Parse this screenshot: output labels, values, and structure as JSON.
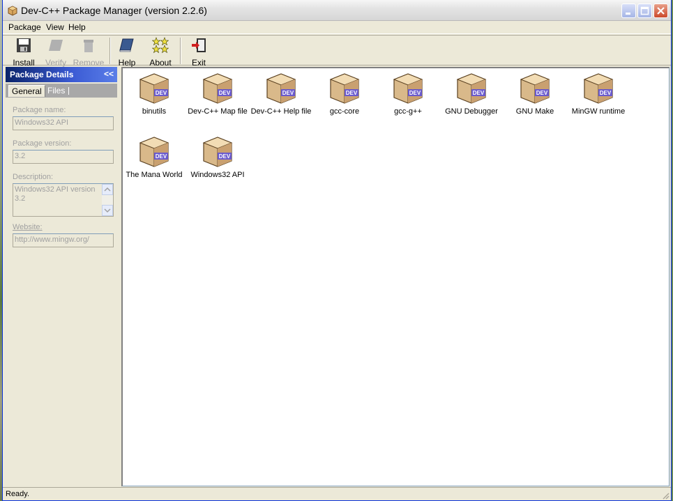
{
  "window": {
    "title": "Dev-C++ Package Manager (version 2.2.6)",
    "app_icon": "package-icon"
  },
  "menu": {
    "items": [
      "Package",
      "View",
      "Help"
    ]
  },
  "toolbar": {
    "install": "Install",
    "verify": "Verify",
    "remove": "Remove",
    "help": "Help",
    "about": "About",
    "exit": "Exit"
  },
  "panel": {
    "title": "Package Details",
    "collapse": "<<",
    "tabs": [
      "General",
      "Files"
    ],
    "name_label": "Package name:",
    "name_value": "Windows32 API",
    "version_label": "Package version:",
    "version_value": "3.2",
    "description_label": "Description:",
    "description_value": "Windows32 API version 3.2",
    "website_label": "Website:",
    "website_value": "http://www.mingw.org/"
  },
  "packages": [
    {
      "label": "binutils"
    },
    {
      "label": "Dev-C++ Map file"
    },
    {
      "label": "Dev-C++ Help file"
    },
    {
      "label": "gcc-core"
    },
    {
      "label": "gcc-g++"
    },
    {
      "label": "GNU Debugger"
    },
    {
      "label": "GNU Make"
    },
    {
      "label": "MinGW runtime"
    },
    {
      "label": "The Mana World"
    },
    {
      "label": "Windows32 API"
    }
  ],
  "package_badge": "DEV",
  "status": {
    "text": "Ready."
  },
  "colors": {
    "panel_header": "#0a246a",
    "box_tan": "#d9b98a",
    "badge": "#6a5acd"
  }
}
